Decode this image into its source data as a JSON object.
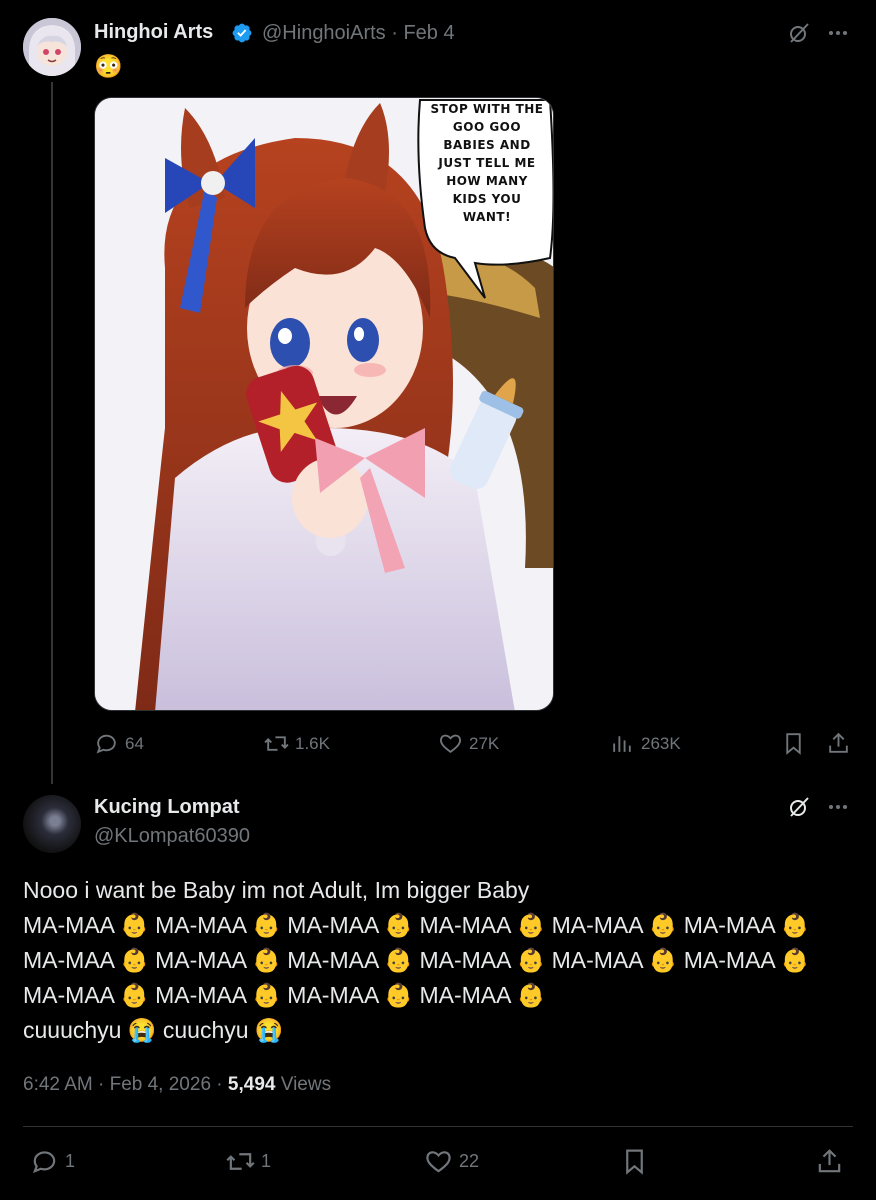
{
  "tweet": {
    "author_name": "Hinghoi Arts",
    "handle_date": "@HinghoiArts · Feb 4",
    "text": "😳",
    "image": {
      "speech_bubble": "STOP WITH THE GOO GOO BABIES AND JUST TELL ME HOW MANY KIDS YOU WANT!"
    },
    "stats": {
      "replies": "64",
      "reposts": "1.6K",
      "likes": "27K",
      "views": "263K"
    }
  },
  "reply": {
    "author_name": "Kucing Lompat",
    "handle": "@KLompat60390",
    "text": "Nooo i want be Baby im not Adult, Im bigger Baby\nMA-MAA 👶 MA-MAA 👶 MA-MAA 👶 MA-MAA 👶 MA-MAA 👶 MA-MAA 👶 MA-MAA 👶 MA-MAA 👶 MA-MAA 👶 MA-MAA 👶 MA-MAA 👶 MA-MAA 👶 MA-MAA 👶 MA-MAA 👶 MA-MAA 👶 MA-MAA 👶\ncuuuchyu 😭 cuuchyu 😭",
    "time": "6:42 AM · Feb 4, 2026 ·",
    "views_count": "5,494",
    "views_label": "Views",
    "stats": {
      "replies": "1",
      "reposts": "1",
      "likes": "22"
    }
  },
  "colors": {
    "background": "#000000",
    "text": "#e7e9ea",
    "muted": "#71767b",
    "verified": "#1d9bf0",
    "border": "#2f3336"
  }
}
